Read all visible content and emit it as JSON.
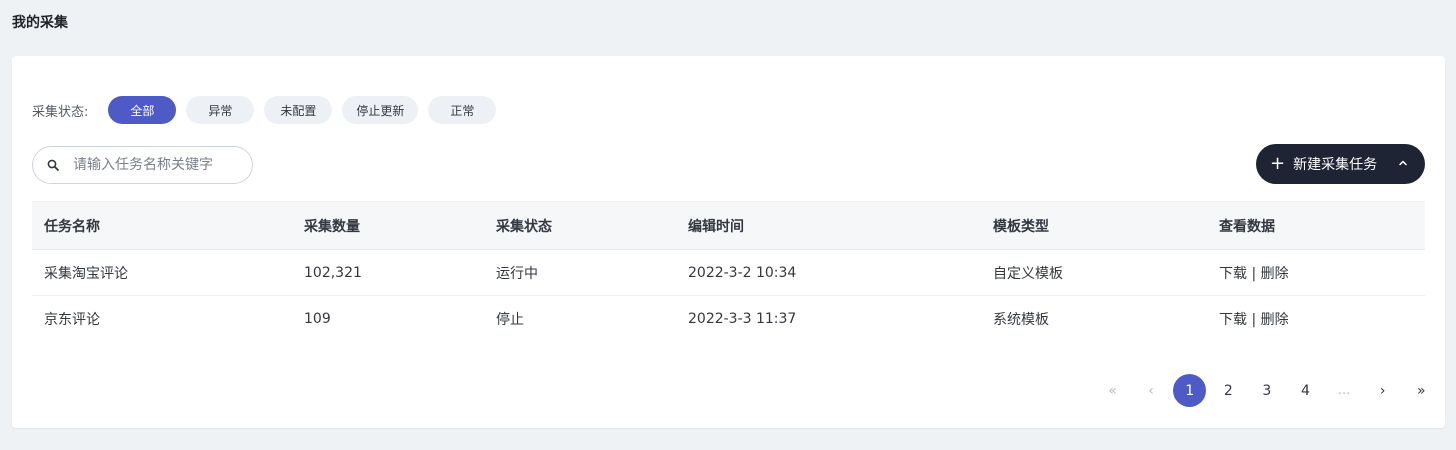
{
  "page": {
    "title": "我的采集"
  },
  "filter": {
    "label": "采集状态:",
    "chips": [
      "全部",
      "异常",
      "未配置",
      "停止更新",
      "正常"
    ],
    "active_index": 0
  },
  "search": {
    "placeholder": "请输入任务名称关键字",
    "value": "",
    "icon": "search-icon"
  },
  "new_task_button": {
    "label": "新建采集任务",
    "icon": "plus-icon",
    "chevron": "chevron-up-icon"
  },
  "table": {
    "headers": [
      "任务名称",
      "采集数量",
      "采集状态",
      "编辑时间",
      "模板类型",
      "查看数据"
    ],
    "rows": [
      {
        "name": "采集淘宝评论",
        "count": "102,321",
        "status": "运行中",
        "time": "2022-3-2 10:34",
        "template": "自定义模板",
        "download": "下载",
        "sep": "|",
        "delete": "删除"
      },
      {
        "name": "京东评论",
        "count": "109",
        "status": "停止",
        "time": "2022-3-3 11:37",
        "template": "系统模板",
        "download": "下载",
        "sep": "|",
        "delete": "删除"
      }
    ]
  },
  "pagination": {
    "first": "«",
    "prev": "‹",
    "pages": [
      "1",
      "2",
      "3",
      "4"
    ],
    "ellipsis": "...",
    "next": "›",
    "last": "»",
    "current": "1"
  },
  "colors": {
    "accent": "#4e5bc7",
    "dark_button": "#1e2433",
    "background": "#eef2f5"
  }
}
